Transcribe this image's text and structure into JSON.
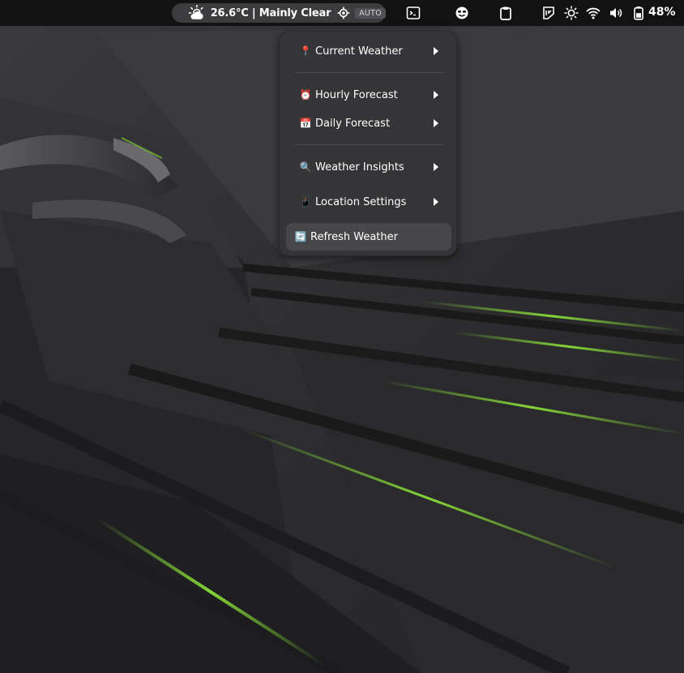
{
  "topbar": {
    "weather": {
      "icon": "cloudy-sun-icon",
      "text": "26.6°C | Mainly Clear",
      "location_icon": "location-crosshair-icon",
      "auto_label": "AUTO"
    },
    "indicators": [
      "terminal-icon",
      "emoji-face-icon",
      "clipboard-icon",
      "keyboard-layout-icon",
      "brightness-icon",
      "wifi-icon",
      "volume-icon",
      "battery-icon"
    ],
    "battery_percent": "48%"
  },
  "menu": {
    "items": [
      {
        "emoji": "📍",
        "label": "Current Weather",
        "has_submenu": true
      },
      {
        "emoji": "⏰",
        "label": "Hourly Forecast",
        "has_submenu": true
      },
      {
        "emoji": "📅",
        "label": "Daily Forecast",
        "has_submenu": true
      },
      {
        "emoji": "🔍",
        "label": "Weather Insights",
        "has_submenu": true
      },
      {
        "emoji": "📱",
        "label": "Location Settings",
        "has_submenu": true
      },
      {
        "emoji": "🔄",
        "label": "Refresh Weather",
        "has_submenu": false
      }
    ]
  },
  "colors": {
    "topbar_bg": "#121213",
    "pill_bg": "#3c3c3f",
    "menu_bg": "#353537",
    "hover_bg": "#47474a",
    "accent_green": "#8ee83a"
  }
}
